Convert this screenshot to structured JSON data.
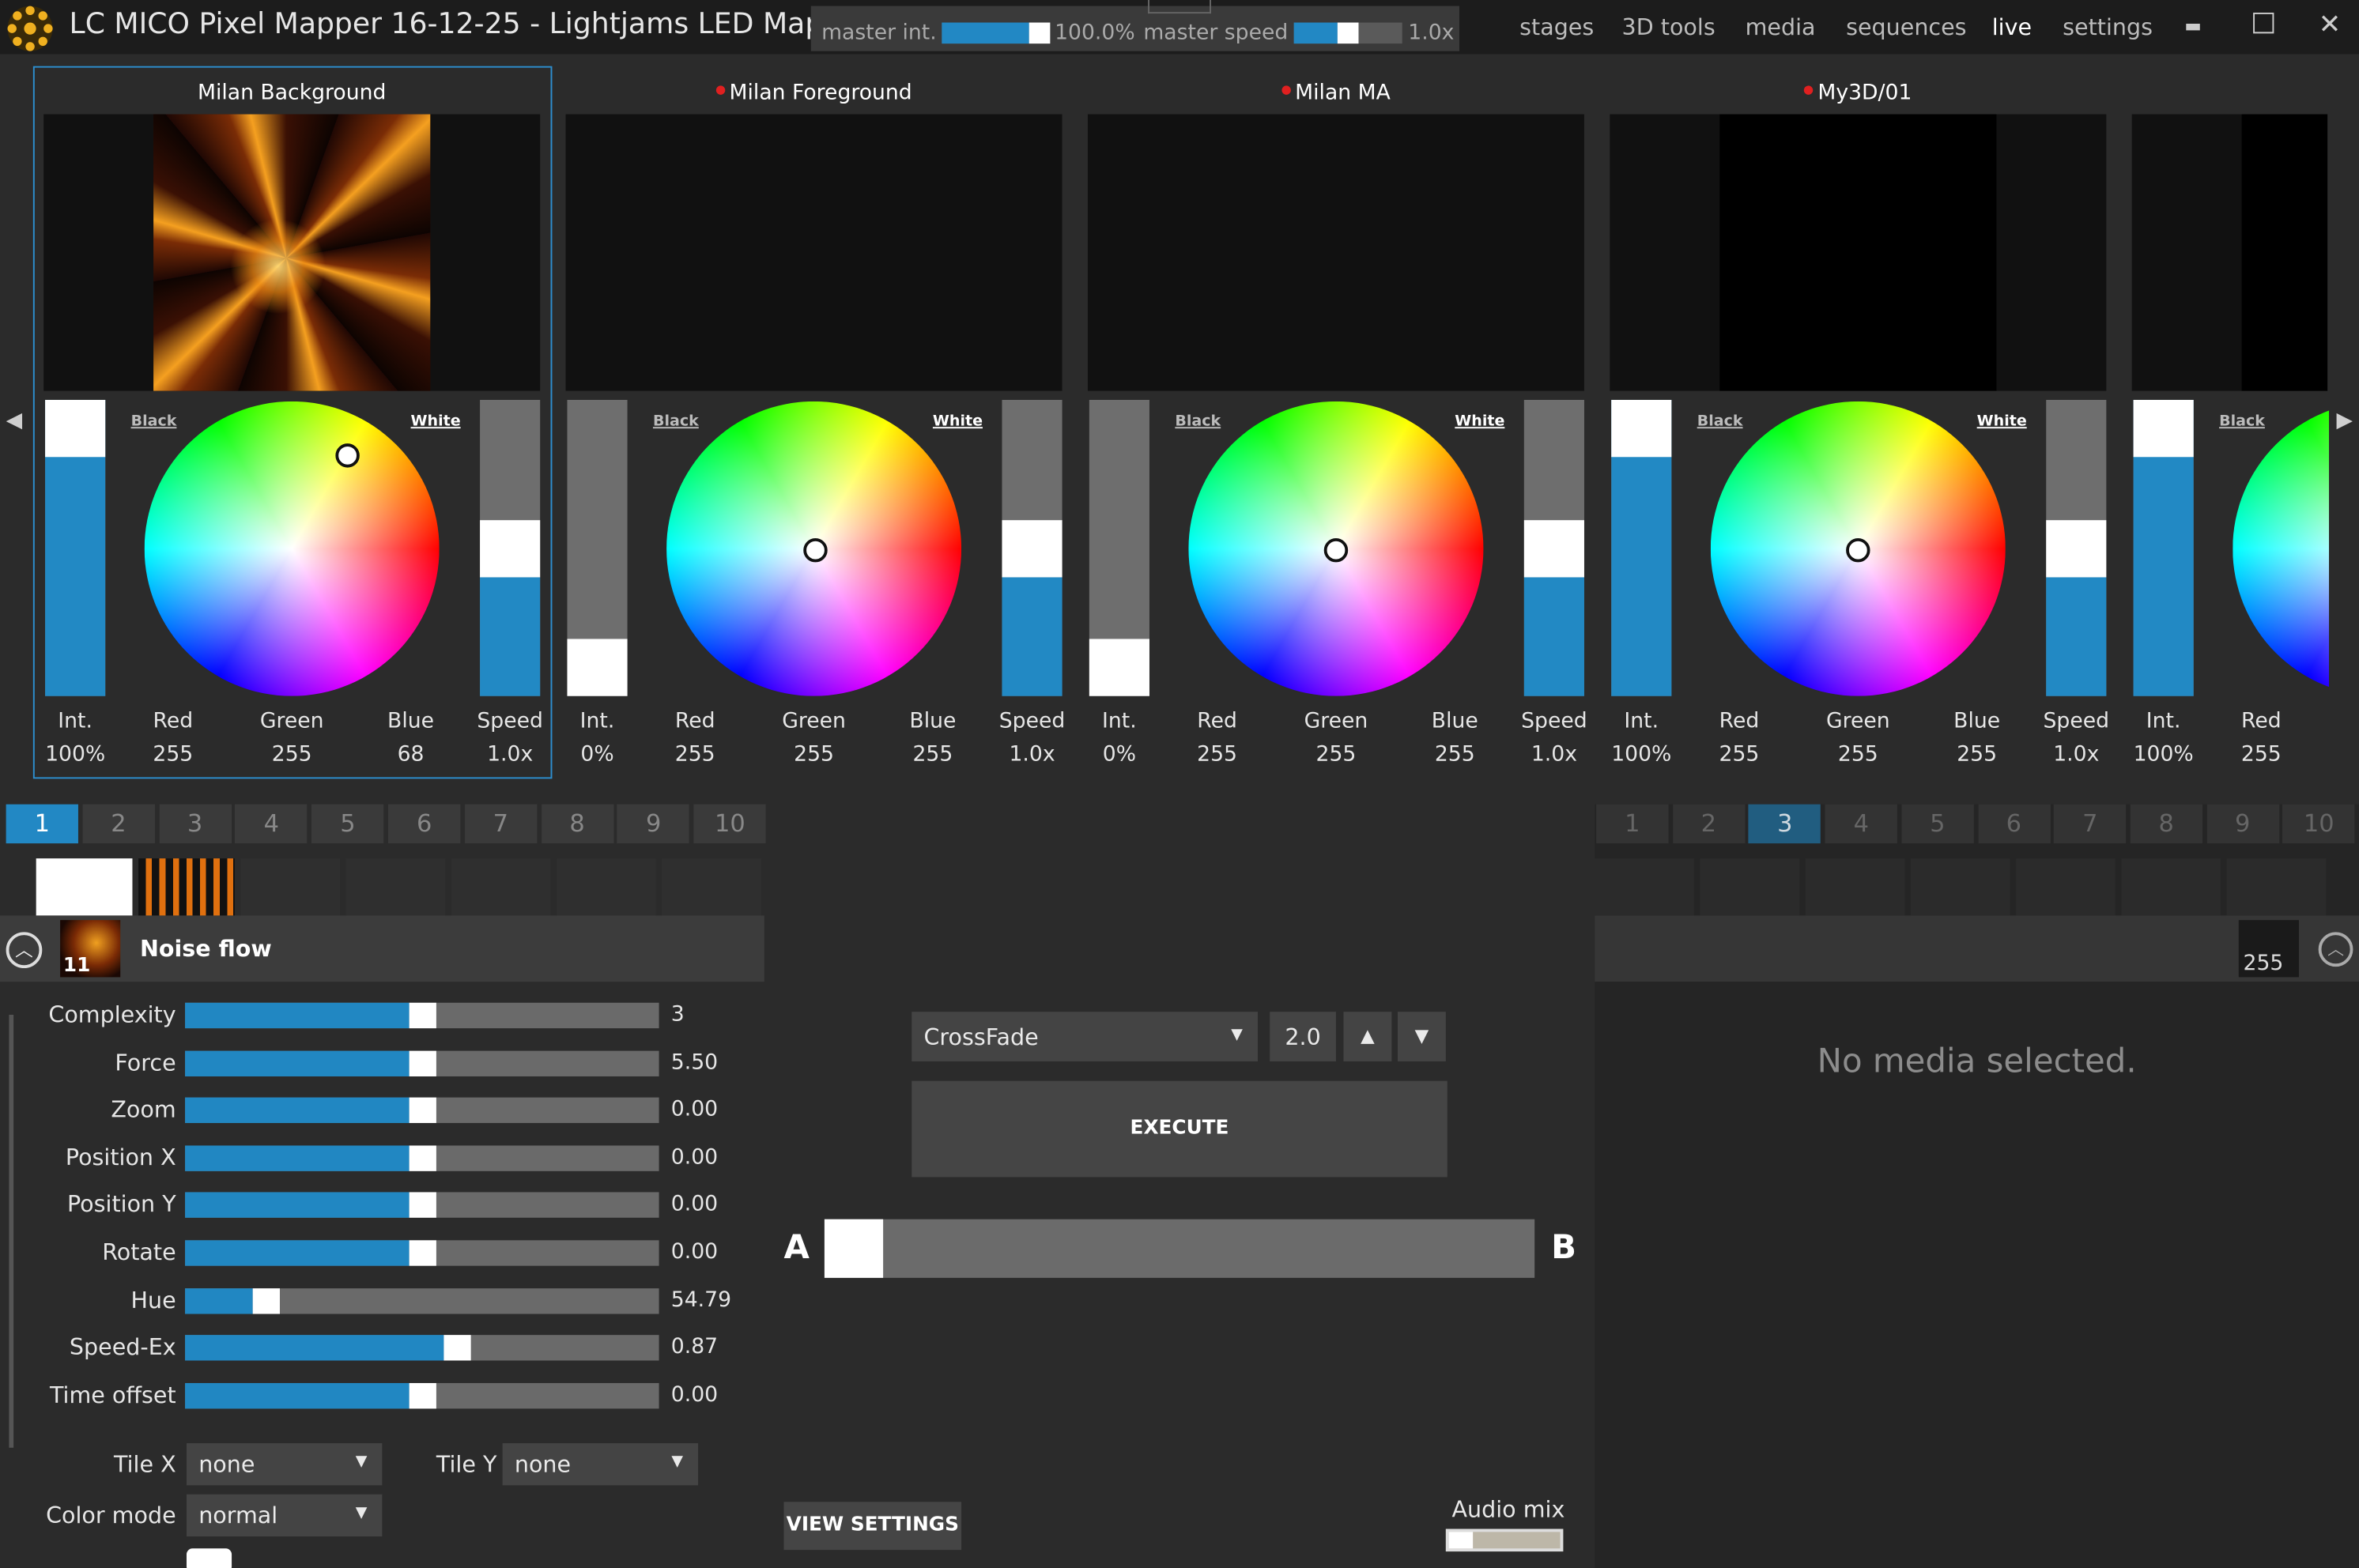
{
  "app": {
    "title": "LC MICO Pixel Mapper 16-12-25 - Lightjams LED Map..."
  },
  "master": {
    "int_label": "master int.",
    "int_value": "100.0%",
    "int_level": 1.0,
    "speed_label": "master speed",
    "speed_value": "1.0x",
    "speed_level": 0.5
  },
  "menu": [
    "stages",
    "3D tools",
    "media",
    "sequences",
    "live",
    "settings"
  ],
  "window": {
    "minimize": "▬",
    "maximize": "□",
    "close": "✕"
  },
  "stages": [
    {
      "name": "Milan Background",
      "dot": false,
      "selected": true,
      "int": "100%",
      "int_level": 1.0,
      "red": "255",
      "green": "255",
      "blue": "68",
      "speed": "1.0x"
    },
    {
      "name": "Milan Foreground",
      "dot": true,
      "selected": false,
      "int": "0%",
      "int_level": 0.0,
      "red": "255",
      "green": "255",
      "blue": "255",
      "speed": "1.0x"
    },
    {
      "name": "Milan MA",
      "dot": true,
      "selected": false,
      "int": "0%",
      "int_level": 0.0,
      "red": "255",
      "green": "255",
      "blue": "255",
      "speed": "1.0x"
    },
    {
      "name": "My3D/01",
      "dot": true,
      "selected": false,
      "int": "100%",
      "int_level": 1.0,
      "red": "255",
      "green": "255",
      "blue": "255",
      "speed": "1.0x"
    },
    {
      "name": "",
      "dot": false,
      "selected": false,
      "int": "100%",
      "int_level": 1.0,
      "red": "255",
      "green": "",
      "blue": "",
      "speed": ""
    }
  ],
  "labels": {
    "black": "Black",
    "white": "White",
    "int": "Int.",
    "red": "Red",
    "green": "Green",
    "blue": "Blue",
    "speed": "Speed"
  },
  "tabs_left": [
    "1",
    "2",
    "3",
    "4",
    "5",
    "6",
    "7",
    "8",
    "9",
    "10"
  ],
  "tabs_left_active": "1",
  "tabs_right": [
    "1",
    "2",
    "3",
    "4",
    "5",
    "6",
    "7",
    "8",
    "9",
    "10"
  ],
  "tabs_right_active": "3",
  "effect": {
    "name": "Noise flow",
    "badge": "11",
    "params": [
      {
        "label": "Complexity",
        "value": "3",
        "level": 0.5
      },
      {
        "label": "Force",
        "value": "5.50",
        "level": 0.5
      },
      {
        "label": "Zoom",
        "value": "0.00",
        "level": 0.5
      },
      {
        "label": "Position X",
        "value": "0.00",
        "level": 0.5
      },
      {
        "label": "Position Y",
        "value": "0.00",
        "level": 0.5
      },
      {
        "label": "Rotate",
        "value": "0.00",
        "level": 0.5
      },
      {
        "label": "Hue",
        "value": "54.79",
        "level": 0.15
      },
      {
        "label": "Speed-Ex",
        "value": "0.87",
        "level": 0.58
      },
      {
        "label": "Time offset",
        "value": "0.00",
        "level": 0.5
      }
    ],
    "tile_x_label": "Tile X",
    "tile_x": "none",
    "tile_y_label": "Tile Y",
    "tile_y": "none",
    "color_mode_label": "Color mode",
    "color_mode": "normal"
  },
  "crossfade": {
    "mode": "CrossFade",
    "duration": "2.0",
    "execute": "EXECUTE",
    "a": "A",
    "b": "B",
    "position": 0.0
  },
  "view_settings": "VIEW SETTINGS",
  "audio_mix": {
    "label": "Audio mix",
    "level": 0.0
  },
  "right_panel": {
    "value_box": "255",
    "empty": "No media selected."
  }
}
